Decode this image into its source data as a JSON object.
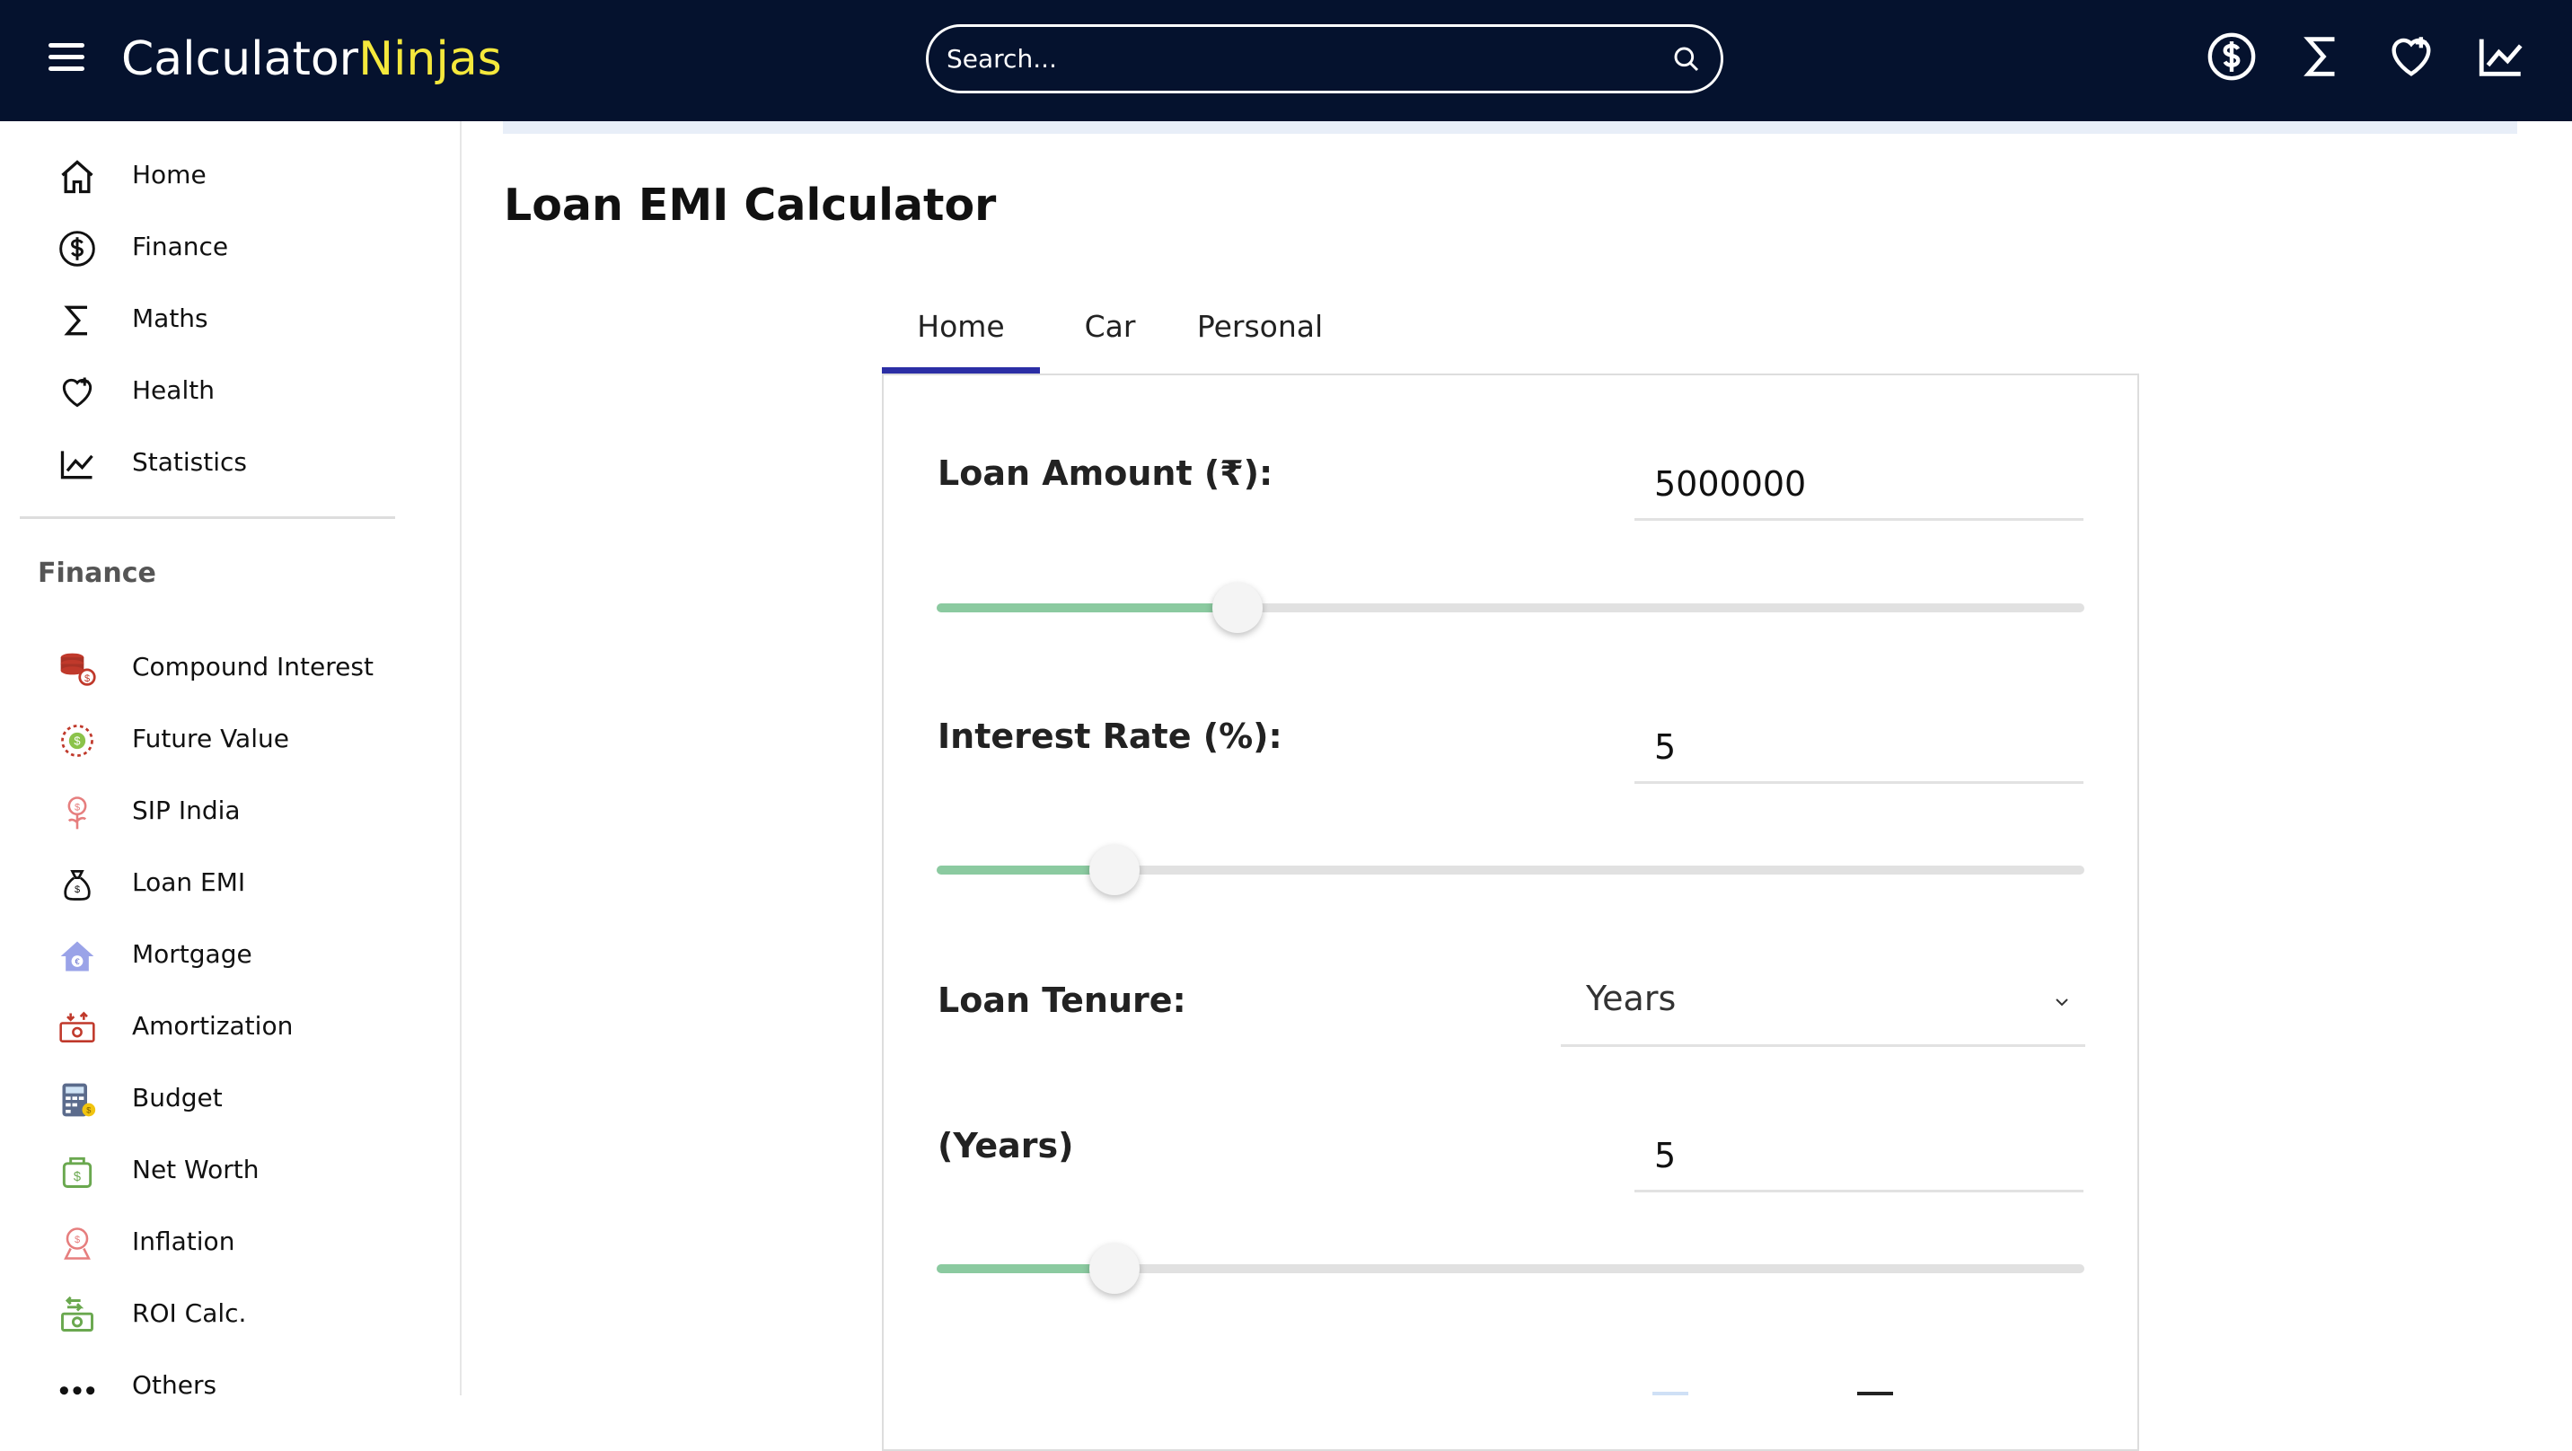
{
  "header": {
    "logo_part1": "Calculator",
    "logo_part2": "Ninjas",
    "search_placeholder": "Search...",
    "icons": [
      "dollar-circle-icon",
      "sigma-icon",
      "heart-plus-icon",
      "chart-line-icon"
    ],
    "brand_color": "#05122e",
    "accent_color": "#f5e83c"
  },
  "sidebar": {
    "main_items": [
      {
        "label": "Home",
        "icon": "home-icon"
      },
      {
        "label": "Finance",
        "icon": "dollar-circle-icon"
      },
      {
        "label": "Maths",
        "icon": "sigma-icon"
      },
      {
        "label": "Health",
        "icon": "heart-plus-icon"
      },
      {
        "label": "Statistics",
        "icon": "chart-line-icon"
      }
    ],
    "section_heading": "Finance",
    "finance_items": [
      {
        "label": "Compound Interest",
        "icon": "coin-stack-icon"
      },
      {
        "label": "Future Value",
        "icon": "target-coin-icon"
      },
      {
        "label": "SIP India",
        "icon": "money-plant-icon"
      },
      {
        "label": "Loan EMI",
        "icon": "money-bag-icon"
      },
      {
        "label": "Mortgage",
        "icon": "house-euro-icon"
      },
      {
        "label": "Amortization",
        "icon": "banknote-icon"
      },
      {
        "label": "Budget",
        "icon": "calculator-icon"
      },
      {
        "label": "Net Worth",
        "icon": "wallet-dollar-icon"
      },
      {
        "label": "Inflation",
        "icon": "inflation-icon"
      },
      {
        "label": "ROI Calc.",
        "icon": "cash-return-icon"
      },
      {
        "label": "Others",
        "icon": "more-dots-icon"
      }
    ]
  },
  "main": {
    "title": "Loan EMI Calculator",
    "tabs": [
      {
        "label": "Home",
        "active": true
      },
      {
        "label": "Car",
        "active": false
      },
      {
        "label": "Personal",
        "active": false
      }
    ],
    "loan_amount": {
      "label": "Loan Amount (₹):",
      "value": "5000000",
      "slider_fraction": 0.262
    },
    "interest_rate": {
      "label": "Interest Rate (%):",
      "value": "5",
      "slider_fraction": 0.155
    },
    "loan_tenure": {
      "label": "Loan Tenure:",
      "selected": "Years"
    },
    "years": {
      "label": "(Years)",
      "value": "5",
      "slider_fraction": 0.155
    },
    "slider_fill_color": "#8bcaa0",
    "tab_active_color": "#2b2ea5"
  }
}
